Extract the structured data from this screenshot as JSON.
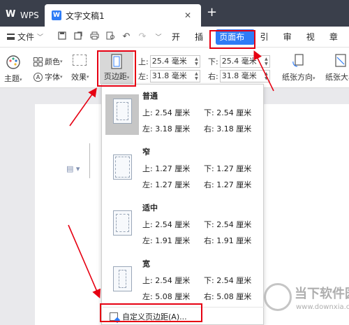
{
  "tabs": {
    "app_name": "WPS",
    "doc_name": "文字文稿1",
    "doc_icon": "W",
    "close": "✕",
    "add": "+"
  },
  "menu": {
    "file_label": "文件",
    "items": [
      "开始",
      "插入",
      "页面布局",
      "引用",
      "审阅",
      "视图",
      "章节"
    ],
    "active_index": 2
  },
  "ribbon": {
    "theme_label": "主题",
    "color_label": "颜色",
    "font_label": "字体",
    "effect_label": "效果",
    "margin_label": "页边距",
    "top_label": "上:",
    "top_value": "25.4 毫米",
    "bottom_label": "下:",
    "bottom_value": "25.4 毫米",
    "left_label": "左:",
    "left_value": "31.8 毫米",
    "right_label": "右:",
    "right_value": "31.8 毫米",
    "orientation_label": "纸张方向",
    "size_label": "纸张大小"
  },
  "dropdown": {
    "presets": [
      {
        "name": "普通",
        "top": "上: 2.54 厘米",
        "bottom": "下: 2.54 厘米",
        "left": "左: 3.18 厘米",
        "right": "右: 3.18 厘米"
      },
      {
        "name": "窄",
        "top": "上: 1.27 厘米",
        "bottom": "下: 1.27 厘米",
        "left": "左: 1.27 厘米",
        "right": "右: 1.27 厘米"
      },
      {
        "name": "适中",
        "top": "上: 2.54 厘米",
        "bottom": "下: 2.54 厘米",
        "left": "左: 1.91 厘米",
        "right": "右: 1.91 厘米"
      },
      {
        "name": "宽",
        "top": "上: 2.54 厘米",
        "bottom": "下: 2.54 厘米",
        "left": "左: 5.08 厘米",
        "right": "右: 5.08 厘米"
      }
    ],
    "custom_label": "自定义页边距(A)..."
  },
  "watermark": {
    "text": "当下软件园",
    "url": "www.downxia.com"
  },
  "colors": {
    "accent": "#2f7cf6",
    "highlight": "#e60012",
    "tabbar": "#3a3f4b"
  }
}
